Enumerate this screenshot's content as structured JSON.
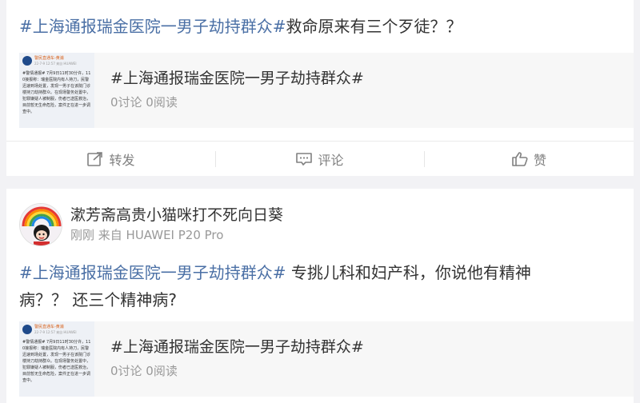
{
  "posts": [
    {
      "text_hashtag": "#上海通报瑞金医院一男子劫持群众#",
      "text_rest": "救命原来有三个歹徒？？",
      "topic": {
        "thumb_account": "警民直通车-黄浦",
        "thumb_time": "22-7-9 12:57 来自 HUAWEI",
        "thumb_body": "#警情通报# 7月9日11时30分许，110接报称：瑞金医院内有人持刀，民警迅速到场处置，发现一男子在该院门诊楼持刀劫持群众。在现场警务处置中，犯罪嫌疑人被制服，伤者已送医救治，目前暂无生命危险，案件正在进一步调查中。",
        "title": "#上海通报瑞金医院一男子劫持群众#",
        "stats": "0讨论 0阅读"
      },
      "actions": {
        "repost": "转发",
        "comment": "评论",
        "like": "赞"
      }
    },
    {
      "user_name": "漱芳斋高贵小猫咪打不死向日葵",
      "meta": "刚刚 来自 HUAWEI P20 Pro",
      "text_hashtag": "#上海通报瑞金医院一男子劫持群众#",
      "text_line1_rest": " 专挑儿科和妇产科，你说他有精神",
      "text_line2": "病？？ 还三个精神病?",
      "topic": {
        "thumb_account": "警民直通车-黄浦",
        "thumb_time": "22-7-9 12:57 来自 HUAWEI",
        "thumb_body": "#警情通报# 7月9日11时30分许，110接报称：瑞金医院内有人持刀，民警迅速到场处置，发现一男子在该院门诊楼持刀劫持群众。在现场警务处置中，犯罪嫌疑人被制服，伤者已送医救治，目前暂无生命危险，案件正在进一步调查中。",
        "title": "#上海通报瑞金医院一男子劫持群众#",
        "stats": "0讨论 0阅读"
      }
    }
  ],
  "colors": {
    "hashtag": "#4a6fa5",
    "background": "#f2f2f5",
    "muted": "#999999"
  },
  "icons": {
    "repost": "repost-icon",
    "comment": "comment-icon",
    "like": "thumbs-up-icon"
  }
}
